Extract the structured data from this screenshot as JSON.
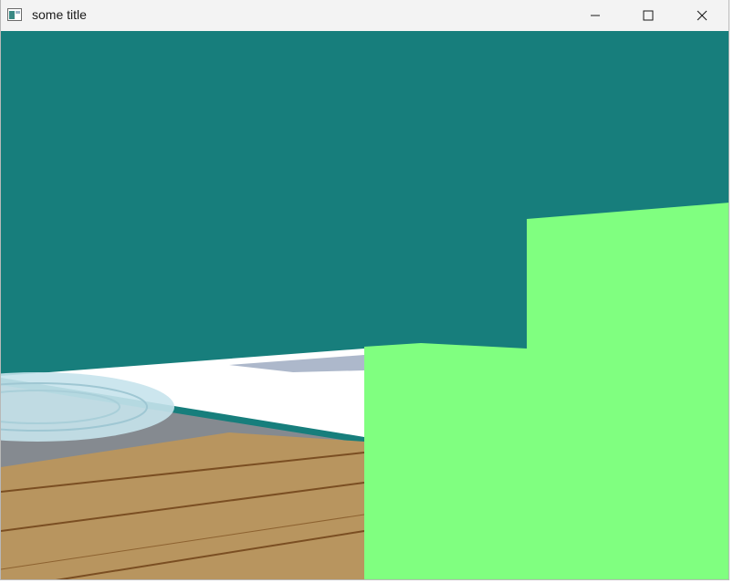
{
  "window": {
    "title": "some title",
    "icons": {
      "app": "app-window-icon",
      "minimize": "minimize-icon",
      "maximize": "maximize-icon",
      "close": "close-icon"
    }
  },
  "scene": {
    "colors": {
      "sky": "#177e7c",
      "green_block": "#80ff80",
      "white_strip": "#ffffff",
      "wood": "#b8955f",
      "wood_dark": "#7a4e22",
      "floor_gray": "#8a8d92",
      "water_light": "#c9e6ee"
    }
  }
}
